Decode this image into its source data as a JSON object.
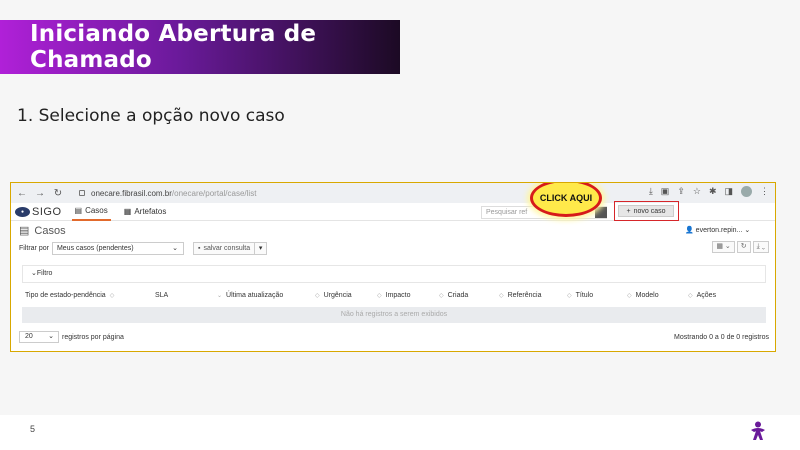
{
  "slide": {
    "title": "Iniciando Abertura de Chamado",
    "step": "1. Selecione a opção novo caso",
    "page_number": "5",
    "accent_color": "#6a1a9a"
  },
  "browser": {
    "url_domain": "onecare.fibrasil.com.br",
    "url_path": "/onecare/portal/case/list",
    "icons": [
      "back-icon",
      "forward-icon",
      "reload-icon",
      "lock-icon",
      "download-icon",
      "translate-icon",
      "share-icon",
      "star-icon",
      "puzzle-icon",
      "sidebar-icon",
      "profile-icon",
      "more-icon"
    ]
  },
  "app": {
    "logo_text": "SIGO",
    "tabs": [
      {
        "label": "Casos",
        "active": true
      },
      {
        "label": "Artefatos",
        "active": false
      }
    ],
    "search_placeholder": "Pesquisar ref",
    "new_case_label": "novo caso",
    "user_label": "everton.repin...",
    "annotation": "CLICK AQUI"
  },
  "page": {
    "title": "Casos",
    "filter_label": "Filtrar por",
    "filter_value": "Meus casos (pendentes)",
    "save_query": "salvar consulta",
    "filter_panel": "Filtro"
  },
  "table": {
    "columns": [
      "Tipo de estado-pendência",
      "SLA",
      "Última atualização",
      "Urgência",
      "Impacto",
      "Criada",
      "Referência",
      "Título",
      "Modelo",
      "Ações"
    ],
    "empty_message": "Não há registros a serem exibidos"
  },
  "footer": {
    "per_page_value": "20",
    "per_page_label": "registros por página",
    "count": "Mostrando 0 a 0 de 0 registros"
  }
}
